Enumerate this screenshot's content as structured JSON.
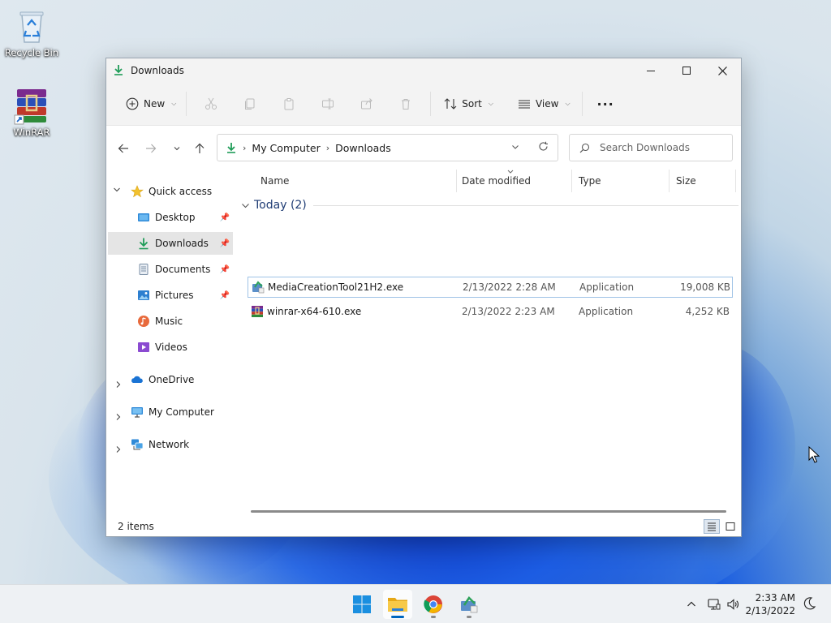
{
  "desktop": {
    "icons": [
      {
        "label": "Recycle Bin",
        "icon": "recycle-bin-icon"
      },
      {
        "label": "WinRAR",
        "icon": "winrar-icon"
      }
    ]
  },
  "window": {
    "title": "Downloads",
    "controls": {
      "minimize": "—",
      "maximize": "☐",
      "close": "✕"
    }
  },
  "toolbar": {
    "new_label": "New",
    "sort_label": "Sort",
    "view_label": "View",
    "more_label": "···",
    "icons": [
      "cut-icon",
      "copy-icon",
      "paste-icon",
      "rename-icon",
      "share-icon",
      "delete-icon"
    ]
  },
  "address": {
    "crumbs": [
      "My Computer",
      "Downloads"
    ],
    "search_placeholder": "Search Downloads"
  },
  "sidebar": {
    "items": [
      {
        "label": "Quick access",
        "icon": "star-icon"
      },
      {
        "label": "Desktop",
        "icon": "desktop-icon",
        "pinned": true
      },
      {
        "label": "Downloads",
        "icon": "download-icon",
        "pinned": true,
        "selected": true
      },
      {
        "label": "Documents",
        "icon": "documents-icon",
        "pinned": true
      },
      {
        "label": "Pictures",
        "icon": "pictures-icon",
        "pinned": true
      },
      {
        "label": "Music",
        "icon": "music-icon"
      },
      {
        "label": "Videos",
        "icon": "videos-icon"
      },
      {
        "label": "OneDrive",
        "icon": "onedrive-icon"
      },
      {
        "label": "My Computer",
        "icon": "computer-icon"
      },
      {
        "label": "Network",
        "icon": "network-icon"
      }
    ]
  },
  "columns": [
    "Name",
    "Date modified",
    "Type",
    "Size"
  ],
  "group": {
    "label": "Today (2)"
  },
  "files": [
    {
      "name": "MediaCreationTool21H2.exe",
      "date": "2/13/2022 2:28 AM",
      "type": "Application",
      "size": "19,008 KB",
      "selected": true
    },
    {
      "name": "winrar-x64-610.exe",
      "date": "2/13/2022 2:23 AM",
      "type": "Application",
      "size": "4,252 KB",
      "selected": false
    }
  ],
  "status": {
    "items_count": "2 items"
  },
  "taskbar": {
    "apps": [
      "start-icon",
      "file-explorer-icon",
      "chrome-icon",
      "media-creation-tool-icon"
    ],
    "time": "2:33 AM",
    "date": "2/13/2022"
  },
  "colors": {
    "accent": "#0067c0",
    "selection": "#e5e5e5",
    "folder": "#f4c542"
  }
}
